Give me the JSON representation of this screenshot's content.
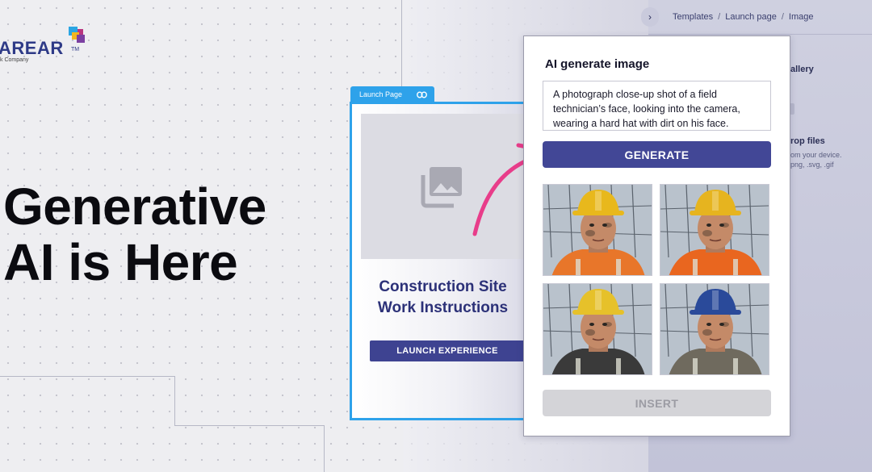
{
  "logo": {
    "wordmark": "AREAR",
    "trademark": "TM",
    "tagline": "k Company"
  },
  "headline": {
    "line1": "Generative",
    "line2": "AI is Here"
  },
  "breadcrumb": {
    "items": [
      "Templates",
      "Launch page",
      "Image"
    ],
    "separator": "/"
  },
  "sidebar": {
    "gallery_label": "allery",
    "drop_title": "rop files",
    "drop_hint_1": "om your device.",
    "drop_hint_2": "png, .svg, .gif"
  },
  "launch_card": {
    "tab_label": "Launch Page",
    "title_line1": "Construction Site",
    "title_line2": "Work Instructions",
    "button_label": "LAUNCH EXPERIENCE"
  },
  "dialog": {
    "title": "AI generate image",
    "prompt": "A photograph close-up shot of a field technician’s face, looking into the camera, wearing a hard hat with dirt on his face.",
    "generate_label": "GENERATE",
    "insert_label": "INSERT",
    "results": [
      {
        "helmet": "#e8b81c",
        "vest": "#e8762a"
      },
      {
        "helmet": "#e6b41f",
        "vest": "#e9661f"
      },
      {
        "helmet": "#e6c12a",
        "vest": "#3a3a3a"
      },
      {
        "helmet": "#2a4a9a",
        "vest": "#6f6a5e"
      }
    ]
  },
  "colors": {
    "brand_navy": "#2c3178",
    "button_indigo": "#424796",
    "accent_blue": "#2ea2ea",
    "arrow_pink": "#e83d8a"
  },
  "icons": [
    "chevron-right-icon",
    "link-icon",
    "image-placeholder-icon",
    "curved-arrow-icon"
  ]
}
